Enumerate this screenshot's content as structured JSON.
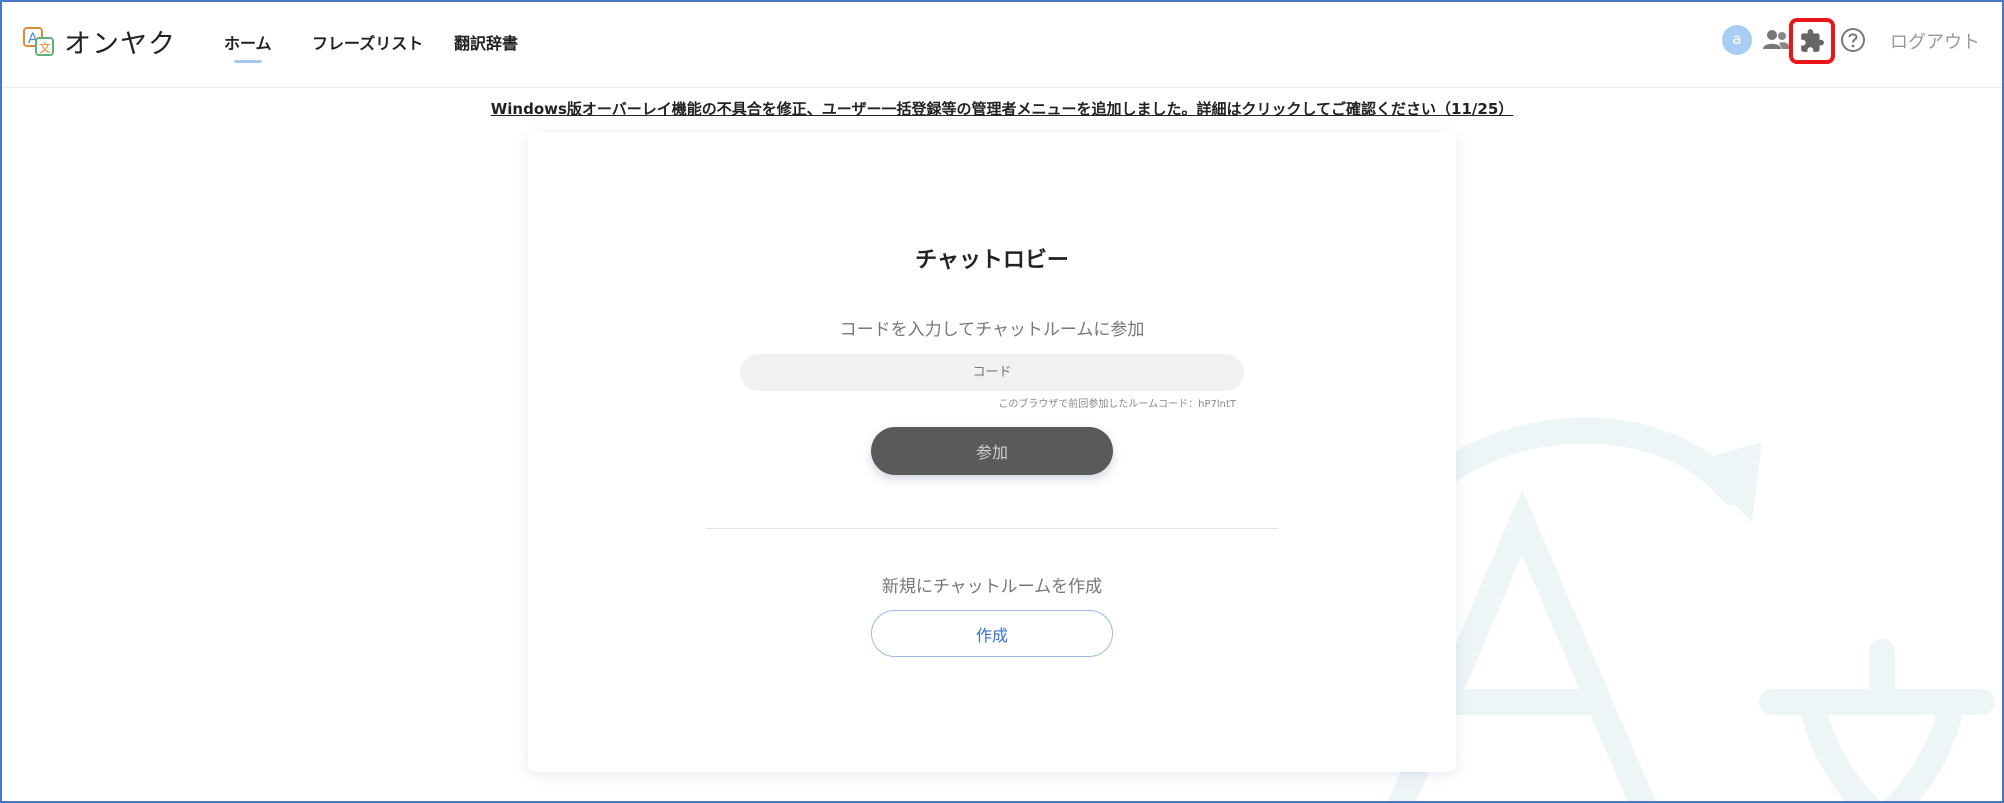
{
  "header": {
    "brand": "オンヤク",
    "nav": {
      "home": "ホーム",
      "phrase_list": "フレーズリスト",
      "dictionary": "翻訳辞書"
    },
    "avatar_letter": "a",
    "logout": "ログアウト"
  },
  "announcement": "Windows版オーバーレイ機能の不具合を修正、ユーザー一括登録等の管理者メニューを追加しました。詳細はクリックしてご確認ください（11/25）",
  "lobby": {
    "title": "チャットロビー",
    "join_label": "コードを入力してチャットルームに参加",
    "code_placeholder": "コード",
    "recent_code_note": "このブラウザで前回参加したルームコード：hP7lntT",
    "join_button": "参加",
    "create_label": "新規にチャットルームを作成",
    "create_button": "作成"
  },
  "colors": {
    "accent_blue": "#3b6fd0",
    "highlight_red": "#e8151b",
    "join_button_bg": "#5a5a5a",
    "avatar_bg": "#a9cdf5"
  },
  "icons": [
    "logo-icon",
    "users-icon",
    "puzzle-icon",
    "help-icon",
    "watermark-translate-icon"
  ]
}
